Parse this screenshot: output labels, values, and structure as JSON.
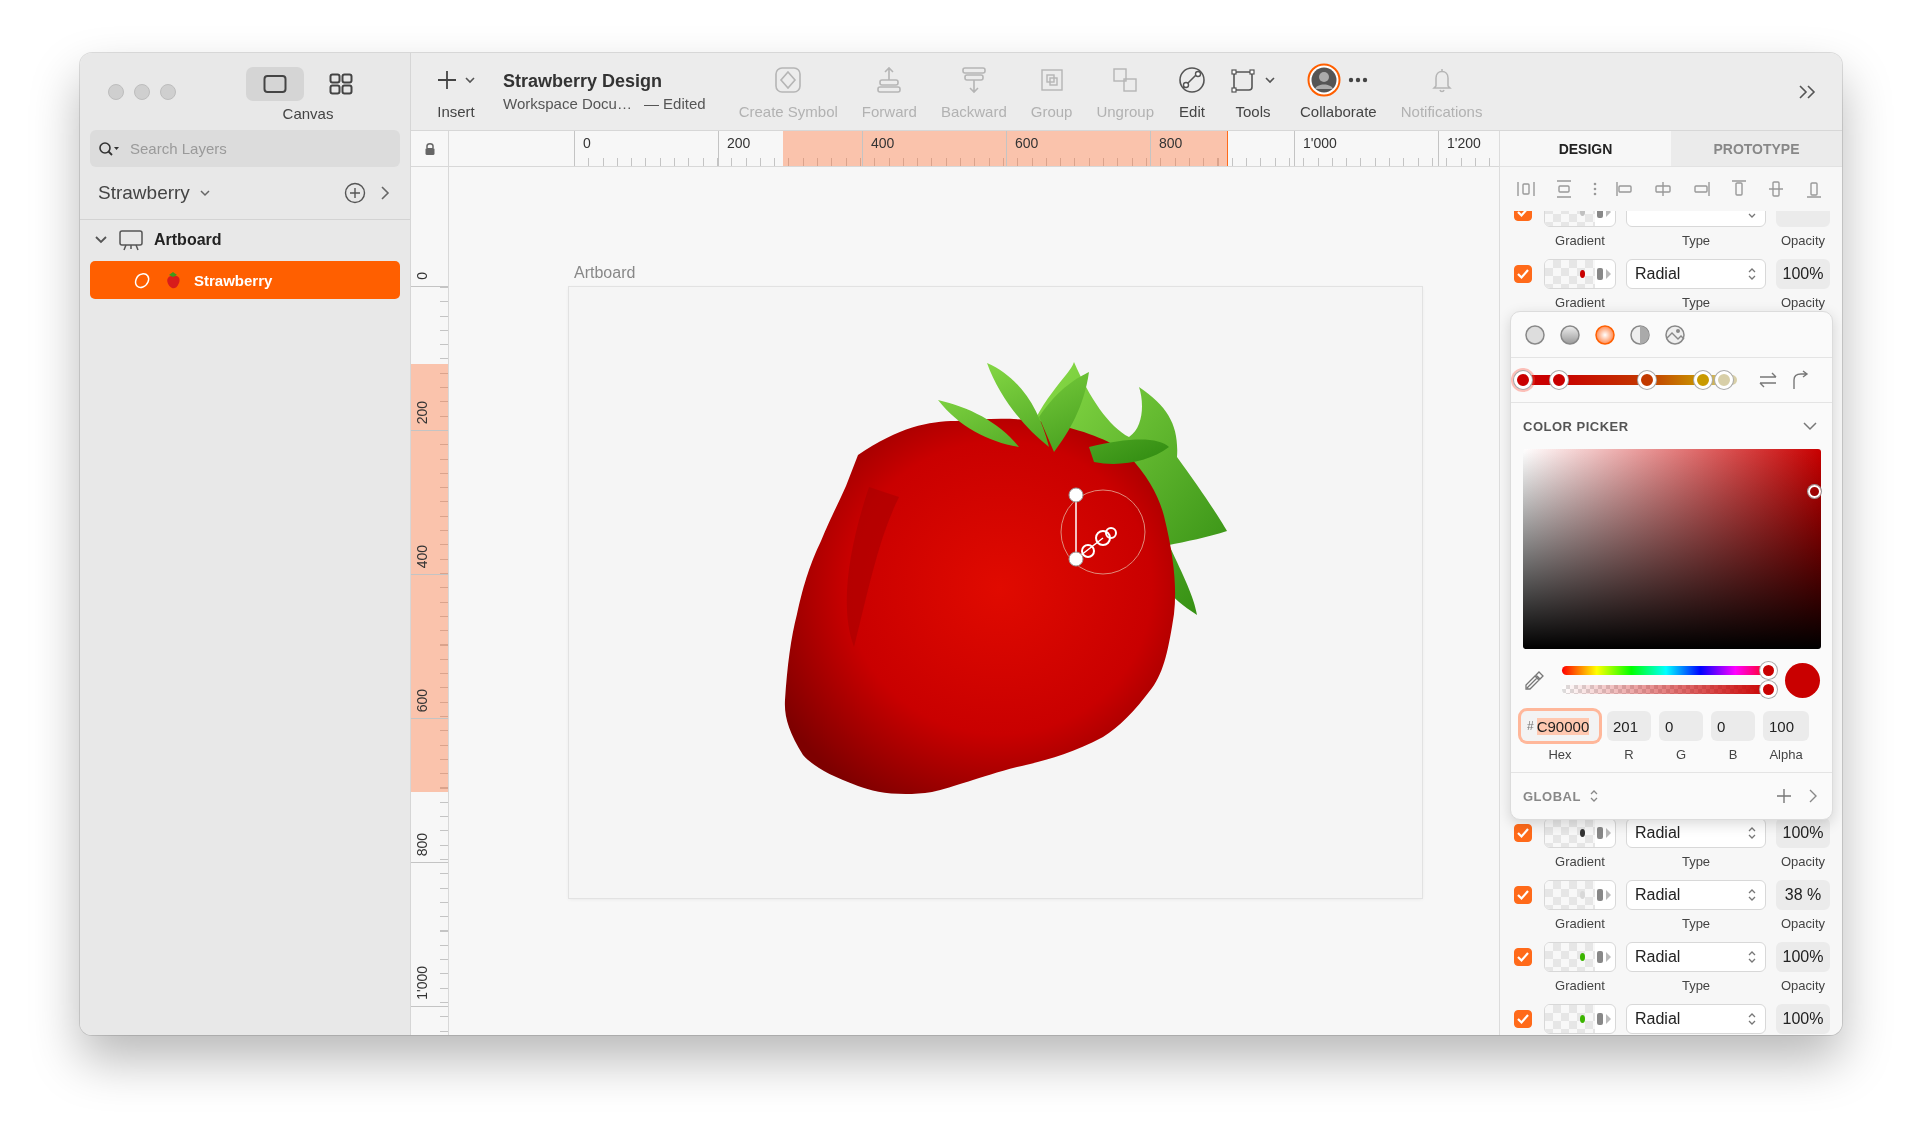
{
  "sidebar": {
    "view_modes": [
      {
        "kind": "canvas",
        "selected": true
      },
      {
        "kind": "grid",
        "selected": false
      }
    ],
    "view_label": "Canvas",
    "search": {
      "placeholder": "Search Layers"
    },
    "page": {
      "name": "Strawberry"
    },
    "layers": [
      {
        "name": "Artboard",
        "kind": "artboard",
        "expanded": true,
        "selected": false,
        "children": [
          {
            "name": "Strawberry",
            "kind": "shape",
            "selected": true
          }
        ]
      }
    ]
  },
  "toolbar": {
    "insert": "Insert",
    "title": "Strawberry Design",
    "subtitle": "Workspace Docu…",
    "status": "— Edited",
    "items": [
      {
        "kind": "create-symbol",
        "label": "Create Symbol",
        "disabled": true
      },
      {
        "kind": "forward",
        "label": "Forward",
        "disabled": true
      },
      {
        "kind": "backward",
        "label": "Backward",
        "disabled": true
      },
      {
        "kind": "group",
        "label": "Group",
        "disabled": true
      },
      {
        "kind": "ungroup",
        "label": "Ungroup",
        "disabled": true
      },
      {
        "kind": "edit",
        "label": "Edit",
        "disabled": false
      },
      {
        "kind": "tools",
        "label": "Tools",
        "disabled": false
      },
      {
        "kind": "collaborate",
        "label": "Collaborate",
        "disabled": false
      },
      {
        "kind": "notifications",
        "label": "Notifications",
        "disabled": true
      }
    ]
  },
  "rulers": {
    "horizontal": [
      "0",
      "200",
      "400",
      "600",
      "800",
      "1'000",
      "1'200"
    ],
    "vertical": [
      "0",
      "200",
      "400",
      "600",
      "800",
      "1'000"
    ]
  },
  "canvas": {
    "artboard_label": "Artboard"
  },
  "inspector": {
    "tabs": [
      {
        "label": "DESIGN",
        "selected": true
      },
      {
        "label": "PROTOTYPE",
        "selected": false
      }
    ],
    "fills_top": [
      {
        "enabled": true,
        "color": "#c0c0c0",
        "gradient_label": "Gradient",
        "type_label": "Type",
        "opacity_label": "Opacity"
      },
      {
        "enabled": true,
        "color": "#c90000",
        "type": "Radial",
        "opacity": "100%",
        "gradient_label": "Gradient",
        "type_label": "Type",
        "opacity_label": "Opacity"
      }
    ],
    "color_picker": {
      "fill_types": [
        {
          "kind": "solid",
          "selected": false
        },
        {
          "kind": "linear",
          "selected": false
        },
        {
          "kind": "radial",
          "selected": true
        },
        {
          "kind": "angular",
          "selected": false
        },
        {
          "kind": "image",
          "selected": false
        }
      ],
      "stops": [
        {
          "color": "#c90000",
          "level": 0,
          "selected": true
        },
        {
          "color": "#c90000",
          "level": 0.17,
          "selected": false
        },
        {
          "color": "#c23a00",
          "level": 0.58,
          "selected": false
        },
        {
          "color": "#c99a00",
          "level": 0.84,
          "selected": false
        },
        {
          "color": "#d8cfa8",
          "level": 0.94,
          "selected": false
        }
      ],
      "title": "COLOR PICKER",
      "hue": {
        "level": 1
      },
      "alpha": {
        "level": 1
      },
      "color": "#c90000",
      "fields": [
        {
          "kind": "hex",
          "prefix": "#",
          "value": "C90000",
          "label": "Hex",
          "focused": true
        },
        {
          "kind": "number",
          "value": "201",
          "label": "R",
          "focused": false
        },
        {
          "kind": "number",
          "value": "0",
          "label": "G",
          "focused": false
        },
        {
          "kind": "number",
          "value": "0",
          "label": "B",
          "focused": false
        },
        {
          "kind": "number",
          "value": "100",
          "label": "Alpha",
          "focused": false
        }
      ],
      "palette": "GLOBAL"
    },
    "fills_bottom": [
      {
        "enabled": true,
        "color": "#333333",
        "type": "Radial",
        "opacity": "100%",
        "gradient_label": "Gradient",
        "type_label": "Type",
        "opacity_label": "Opacity"
      },
      {
        "enabled": true,
        "color": "#d8d8d8",
        "type": "Radial",
        "opacity": "38 %",
        "gradient_label": "Gradient",
        "type_label": "Type",
        "opacity_label": "Opacity"
      },
      {
        "enabled": true,
        "color": "#3cb500",
        "type": "Radial",
        "opacity": "100%",
        "gradient_label": "Gradient",
        "type_label": "Type",
        "opacity_label": "Opacity"
      },
      {
        "enabled": true,
        "color": "#3cb500",
        "type": "Radial",
        "opacity": "100%"
      }
    ]
  }
}
